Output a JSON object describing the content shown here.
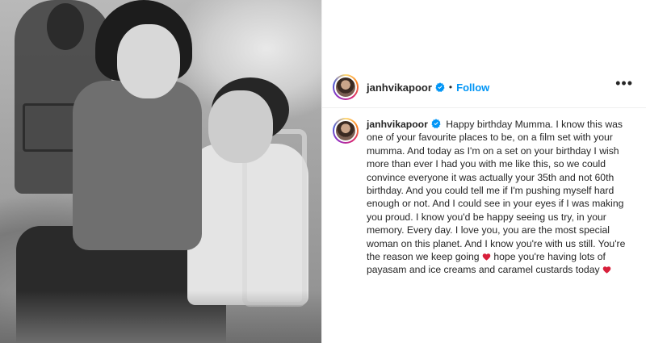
{
  "post": {
    "username": "janhvikapoor",
    "separator": "•",
    "follow_label": "Follow",
    "more_label": "•••"
  },
  "caption": {
    "username": "janhvikapoor",
    "text_part1": "Happy birthday Mumma. I know this was one of your favourite places to be, on a film set with your mumma. And today as I'm on a set on your birthday I wish more than ever I had you with me like this, so we could convince everyone it was actually your 35th and not 60th birthday. And you could tell me if I'm pushing myself hard enough or not. And I could see in your eyes if I was making you proud. I know you'd be happy seeing us try, in your memory. Every day. I love you, you are the most special woman on this planet. And I know you're with us still. You're the reason we keep going",
    "text_part2": " hope you're having lots of payasam and ice creams and caramel custards today"
  },
  "icons": {
    "verified": "verified-badge-icon",
    "heart": "heart-icon",
    "more": "more-options-icon"
  },
  "colors": {
    "follow": "#0095f6",
    "verified": "#0095f6",
    "heart": "#d8203b"
  }
}
